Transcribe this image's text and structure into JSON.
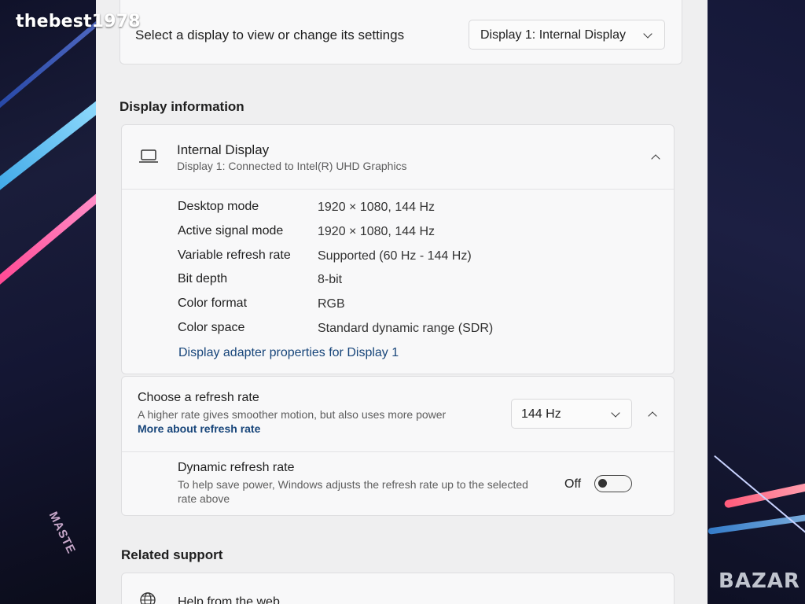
{
  "overlay": {
    "watermark": "thebest1978",
    "brand": "BAZAR",
    "desktop_logo": "MASTE"
  },
  "select_display": {
    "label": "Select a display to view or change its settings",
    "dropdown_value": "Display 1: Internal Display"
  },
  "display_info": {
    "heading": "Display information",
    "title": "Internal Display",
    "subtitle": "Display 1: Connected to Intel(R) UHD Graphics",
    "icon": "laptop-icon",
    "rows": [
      {
        "label": "Desktop mode",
        "value": "1920 × 1080, 144 Hz"
      },
      {
        "label": "Active signal mode",
        "value": "1920 × 1080, 144 Hz"
      },
      {
        "label": "Variable refresh rate",
        "value": "Supported (60 Hz - 144 Hz)"
      },
      {
        "label": "Bit depth",
        "value": "8-bit"
      },
      {
        "label": "Color format",
        "value": "RGB"
      },
      {
        "label": "Color space",
        "value": "Standard dynamic range (SDR)"
      }
    ],
    "adapter_link": "Display adapter properties for Display 1"
  },
  "refresh_rate": {
    "title": "Choose a refresh rate",
    "description": "A higher rate gives smoother motion, but also uses more power",
    "link": "More about refresh rate",
    "value": "144 Hz"
  },
  "dynamic_refresh": {
    "title": "Dynamic refresh rate",
    "description_line1": "To help save power, Windows adjusts the refresh rate up to the selected",
    "description_line2": "rate above",
    "state_label": "Off",
    "enabled": false
  },
  "related_support": {
    "heading": "Related support",
    "item": "Help from the web",
    "icon": "globe-icon"
  },
  "colors": {
    "accent_link": "#17457a",
    "panel_bg": "#efeff0",
    "card_bg": "#f8f8f9"
  }
}
